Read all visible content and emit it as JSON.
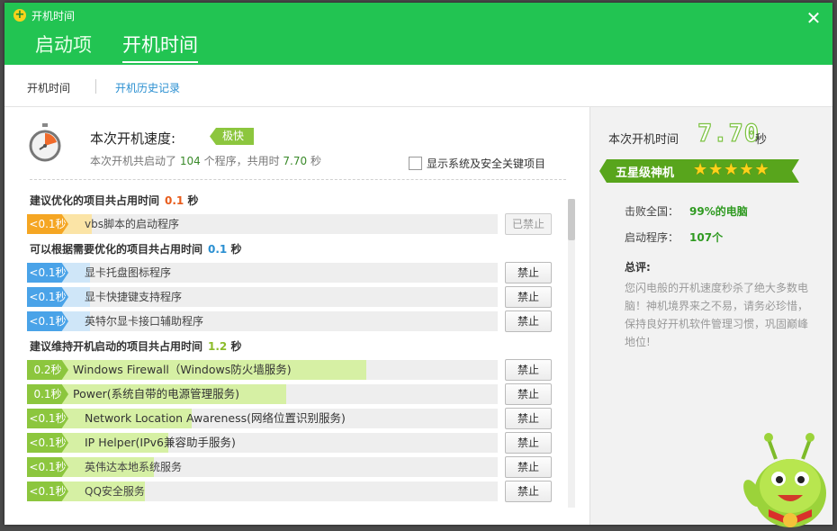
{
  "app": {
    "title": "开机时间"
  },
  "main_tabs": [
    {
      "label": "启动项"
    },
    {
      "label": "开机时间"
    }
  ],
  "sub_tabs": [
    {
      "label": "开机时间"
    },
    {
      "label": "开机历史记录"
    }
  ],
  "summary": {
    "speed_label": "本次开机速度:",
    "speed_badge": "极快",
    "sub_prefix": "本次开机共启动了",
    "program_count": "104",
    "sub_mid": "个程序，共用时",
    "total_time": "7.70",
    "sub_unit": "秒",
    "checkbox_label": "显示系统及安全关键项目"
  },
  "groups": [
    {
      "title": "建议优化的项目共占用时间",
      "time": "0.1",
      "unit": "秒",
      "items": [
        {
          "time": "<0.1秒",
          "name": "vbs脚本的启动程序",
          "button": "已禁止"
        }
      ]
    },
    {
      "title": "可以根据需要优化的项目共占用时间",
      "time": "0.1",
      "unit": "秒",
      "items": [
        {
          "time": "<0.1秒",
          "name": "显卡托盘图标程序",
          "button": "禁止"
        },
        {
          "time": "<0.1秒",
          "name": "显卡快捷键支持程序",
          "button": "禁止"
        },
        {
          "time": "<0.1秒",
          "name": "英特尔显卡接口辅助程序",
          "button": "禁止"
        }
      ]
    },
    {
      "title": "建议维持开机启动的项目共占用时间",
      "time": "1.2",
      "unit": "秒",
      "items": [
        {
          "time": "0.2秒",
          "name": "Windows Firewall（Windows防火墙服务)",
          "button": "禁止",
          "fill": 0.72
        },
        {
          "time": "0.1秒",
          "name": "Power(系统自带的电源管理服务)",
          "button": "禁止",
          "fill": 0.55
        },
        {
          "time": "<0.1秒",
          "name": "Network Location Awareness(网络位置识别服务)",
          "button": "禁止",
          "fill": 0.35
        },
        {
          "time": "<0.1秒",
          "name": "IP Helper(IPv6兼容助手服务)",
          "button": "禁止",
          "fill": 0.3
        },
        {
          "time": "<0.1秒",
          "name": "英伟达本地系统服务",
          "button": "禁止",
          "fill": 0.27
        },
        {
          "time": "<0.1秒",
          "name": "QQ安全服务",
          "button": "禁止",
          "fill": 0.25
        }
      ]
    }
  ],
  "right_panel": {
    "title": "本次开机时间",
    "time": "7.70",
    "unit": "秒",
    "rank": "五星级神机",
    "stars": "★★★★★",
    "beat_label": "击败全国：",
    "beat_value": "99%的电脑",
    "programs_label": "启动程序：",
    "programs_value": "107个",
    "summary_title": "总评:",
    "summary_text": "您闪电般的开机速度秒杀了绝大多数电脑！神机境界来之不易，请务必珍惜，保持良好开机软件管理习惯，巩固巅峰地位!"
  },
  "colors": {
    "brand_green": "#22c452",
    "orange": "#f5a623",
    "blue": "#4aa3e8",
    "green": "#8cc63e"
  }
}
